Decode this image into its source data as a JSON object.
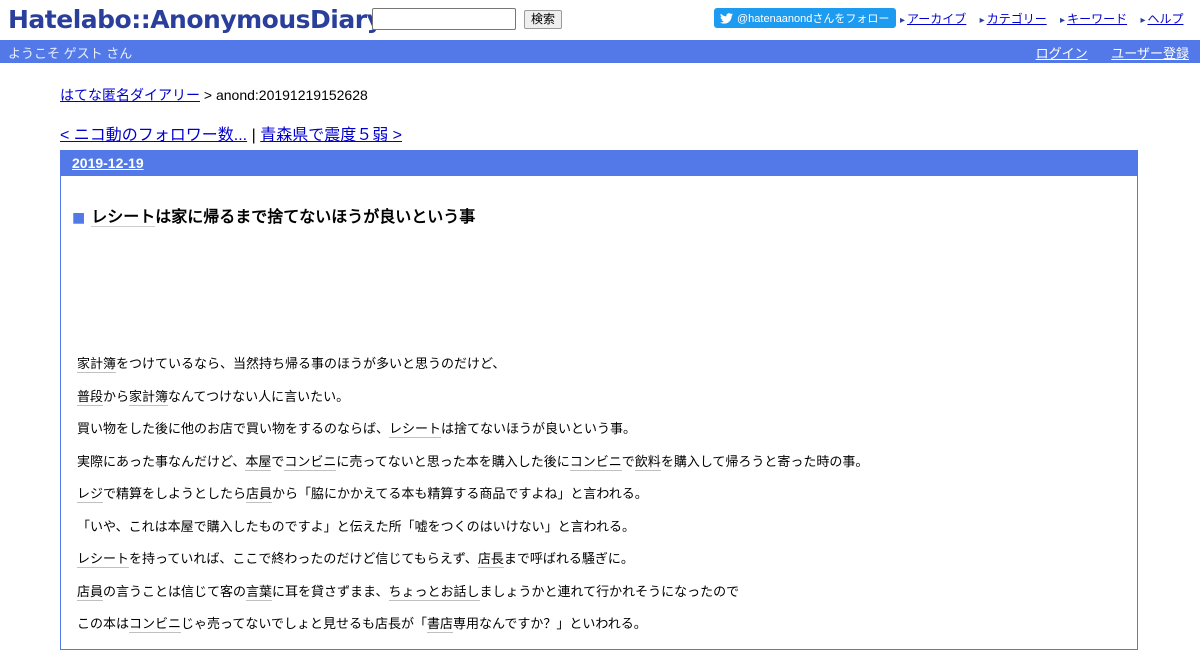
{
  "header": {
    "logo": "Hatelabo::AnonymousDiary",
    "search_placeholder": "",
    "search_button": "検索",
    "follow_button": "@hatenaanondさんをフォロー",
    "links": [
      "アーカイブ",
      "カテゴリー",
      "キーワード",
      "ヘルプ"
    ]
  },
  "userbar": {
    "welcome": "ようこそ ゲスト さん",
    "login": "ログイン",
    "register": "ユーザー登録"
  },
  "breadcrumb": {
    "home": "はてな匿名ダイアリー",
    "separator": " > ",
    "current": "anond:20191219152628"
  },
  "pager": {
    "prev": "< ニコ動のフォロワー数...",
    "divider": " | ",
    "next": "青森県で震度５弱 >"
  },
  "day": {
    "date": "2019-12-19",
    "title_marker": "■",
    "title_keyword": "レシート",
    "title_rest": "は家に帰るまで捨てないほうが良いという事"
  },
  "body": [
    [
      {
        "k": "家計簿"
      },
      {
        "t": "をつけているなら、当然持ち帰る事のほうが多いと思うのだけど、"
      }
    ],
    [
      {
        "k": "普段"
      },
      {
        "t": "から"
      },
      {
        "k": "家計簿"
      },
      {
        "t": "なんてつけない人に言いたい。"
      }
    ],
    [
      {
        "t": "買い物をした後に他のお店で買い物をするのならば、"
      },
      {
        "k": "レシート"
      },
      {
        "t": "は捨てないほうが良いという事。"
      }
    ],
    [
      {
        "t": "実際にあった事なんだけど、"
      },
      {
        "k": "本屋"
      },
      {
        "t": "で"
      },
      {
        "k": "コンビニ"
      },
      {
        "t": "に売ってないと思った本を購入した後に"
      },
      {
        "k": "コンビニ"
      },
      {
        "t": "で"
      },
      {
        "k": "飲料"
      },
      {
        "t": "を購入して帰ろうと寄った時の事。"
      }
    ],
    [
      {
        "k": "レジ"
      },
      {
        "t": "で精算をしようとしたら"
      },
      {
        "k": "店員"
      },
      {
        "t": "から「脇にかかえてる本も精算する商品ですよね」と言われる。"
      }
    ],
    [
      {
        "t": "「いや、これは本屋で購入したものですよ」と伝えた所「嘘をつくのはいけない」と言われる。"
      }
    ],
    [
      {
        "k": "レシート"
      },
      {
        "t": "を持っていれば、ここで終わったのだけど信じてもらえず、"
      },
      {
        "k": "店長"
      },
      {
        "t": "まで呼ばれる騒ぎに。"
      }
    ],
    [
      {
        "k": "店員"
      },
      {
        "t": "の言うことは信じて客の"
      },
      {
        "k": "言葉"
      },
      {
        "t": "に耳を貸さずまま、"
      },
      {
        "k": "ちょっとお話し"
      },
      {
        "t": "ましょうかと連れて行かれそうになったので"
      }
    ],
    [
      {
        "t": "この本は"
      },
      {
        "k": "コンビニ"
      },
      {
        "t": "じゃ売ってないでしょと見せるも店長が「"
      },
      {
        "k": "書店"
      },
      {
        "t": "専用なんですか？」といわれる。"
      }
    ]
  ]
}
